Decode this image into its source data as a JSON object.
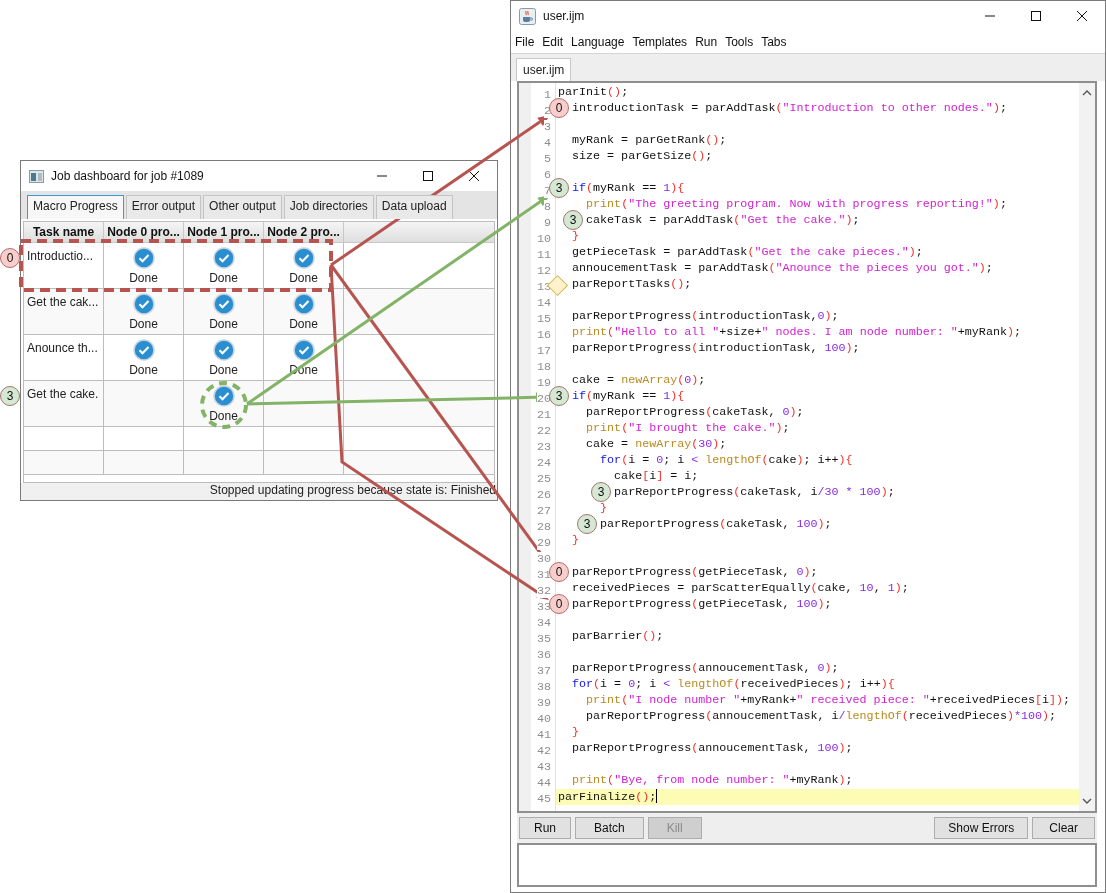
{
  "dashboard": {
    "title": "Job dashboard for job #1089",
    "tabs": [
      {
        "label": "Macro Progress",
        "selected": true
      },
      {
        "label": "Error output",
        "selected": false
      },
      {
        "label": "Other output",
        "selected": false
      },
      {
        "label": "Job directories",
        "selected": false
      },
      {
        "label": "Data upload",
        "selected": false
      }
    ],
    "columns": [
      "Task name",
      "Node 0 pro...",
      "Node 1 pro...",
      "Node 2 pro..."
    ],
    "rows": [
      {
        "marker": {
          "label": "0",
          "color": "#f8cecc"
        },
        "cells": [
          {
            "kind": "text",
            "text": "Introductio..."
          },
          {
            "kind": "status",
            "done": true,
            "status": "Done"
          },
          {
            "kind": "status",
            "done": true,
            "status": "Done"
          },
          {
            "kind": "status",
            "done": true,
            "status": "Done"
          }
        ]
      },
      {
        "cells": [
          {
            "kind": "text",
            "text": "Get the cak..."
          },
          {
            "kind": "status",
            "done": true,
            "status": "Done"
          },
          {
            "kind": "status",
            "done": true,
            "status": "Done"
          },
          {
            "kind": "status",
            "done": true,
            "status": "Done"
          }
        ]
      },
      {
        "cells": [
          {
            "kind": "text",
            "text": "Anounce th..."
          },
          {
            "kind": "status",
            "done": true,
            "status": "Done"
          },
          {
            "kind": "status",
            "done": true,
            "status": "Done"
          },
          {
            "kind": "status",
            "done": true,
            "status": "Done"
          }
        ]
      },
      {
        "marker": {
          "label": "3",
          "color": "#d5e8d4"
        },
        "cells": [
          {
            "kind": "text",
            "text": "Get the cake."
          },
          {
            "kind": "status",
            "done": false
          },
          {
            "kind": "status",
            "done": true,
            "status": "Done"
          },
          {
            "kind": "status",
            "done": false
          }
        ]
      }
    ],
    "status_bar": "Stopped updating progress because state is: Finished"
  },
  "editor": {
    "title": "user.ijm",
    "menu": [
      "File",
      "Edit",
      "Language",
      "Templates",
      "Run",
      "Tools",
      "Tabs"
    ],
    "file_tabs": [
      {
        "label": "user.ijm",
        "selected": true
      }
    ],
    "lines": [
      {
        "number": "1",
        "current": false,
        "tokens": [
          {
            "kind": "plain",
            "text": "parInit"
          },
          {
            "kind": "bracket",
            "text": "()"
          },
          {
            "kind": "plain",
            "text": ";"
          }
        ]
      },
      {
        "number": "2",
        "current": false,
        "marker": {
          "kind": "number",
          "label": "0",
          "color": "#f8cecc"
        },
        "tokens": [
          {
            "kind": "plain",
            "text": "  introductionTask = parAddTask"
          },
          {
            "kind": "bracket",
            "text": "("
          },
          {
            "kind": "string",
            "text": "\"Introduction to other nodes.\""
          },
          {
            "kind": "bracket",
            "text": ")"
          },
          {
            "kind": "plain",
            "text": ";"
          }
        ]
      },
      {
        "number": "3",
        "current": false
      },
      {
        "number": "4",
        "current": false,
        "tokens": [
          {
            "kind": "plain",
            "text": "  myRank = parGetRank"
          },
          {
            "kind": "bracket",
            "text": "()"
          },
          {
            "kind": "plain",
            "text": ";"
          }
        ]
      },
      {
        "number": "5",
        "current": false,
        "tokens": [
          {
            "kind": "plain",
            "text": "  size = parGetSize"
          },
          {
            "kind": "bracket",
            "text": "()"
          },
          {
            "kind": "plain",
            "text": ";"
          }
        ]
      },
      {
        "number": "6",
        "current": false
      },
      {
        "number": "7",
        "current": false,
        "marker": {
          "kind": "number",
          "label": "3",
          "color": "#d5e8d4"
        },
        "tokens": [
          {
            "kind": "keyword",
            "text": "  if"
          },
          {
            "kind": "bracket",
            "text": "("
          },
          {
            "kind": "plain",
            "text": "myRank == "
          },
          {
            "kind": "number",
            "text": "1"
          },
          {
            "kind": "bracket",
            "text": "){"
          }
        ]
      },
      {
        "number": "8",
        "current": false,
        "tokens": [
          {
            "kind": "builtin",
            "text": "    print"
          },
          {
            "kind": "bracket",
            "text": "("
          },
          {
            "kind": "string",
            "text": "\"The greeting program. Now with progress reporting!\""
          },
          {
            "kind": "bracket",
            "text": ")"
          },
          {
            "kind": "plain",
            "text": ";"
          }
        ]
      },
      {
        "number": "9",
        "current": false,
        "marker": {
          "kind": "number",
          "label": "3",
          "color": "#d5e8d4"
        },
        "tokens": [
          {
            "kind": "plain",
            "text": "    cakeTask = parAddTask"
          },
          {
            "kind": "bracket",
            "text": "("
          },
          {
            "kind": "string",
            "text": "\"Get the cake.\""
          },
          {
            "kind": "bracket",
            "text": ")"
          },
          {
            "kind": "plain",
            "text": ";"
          }
        ]
      },
      {
        "number": "10",
        "current": false,
        "tokens": [
          {
            "kind": "bracket",
            "text": "  }"
          }
        ]
      },
      {
        "number": "11",
        "current": false,
        "tokens": [
          {
            "kind": "plain",
            "text": "  getPieceTask = parAddTask"
          },
          {
            "kind": "bracket",
            "text": "("
          },
          {
            "kind": "string",
            "text": "\"Get the cake pieces.\""
          },
          {
            "kind": "bracket",
            "text": ")"
          },
          {
            "kind": "plain",
            "text": ";"
          }
        ]
      },
      {
        "number": "12",
        "current": false,
        "tokens": [
          {
            "kind": "plain",
            "text": "  annoucementTask = parAddTask"
          },
          {
            "kind": "bracket",
            "text": "("
          },
          {
            "kind": "string",
            "text": "\"Anounce the pieces you got.\""
          },
          {
            "kind": "bracket",
            "text": ")"
          },
          {
            "kind": "plain",
            "text": ";"
          }
        ]
      },
      {
        "number": "13",
        "current": false,
        "marker": {
          "kind": "diamond",
          "color": "#fff2cc"
        },
        "tokens": [
          {
            "kind": "plain",
            "text": "  parReportTasks"
          },
          {
            "kind": "bracket",
            "text": "()"
          },
          {
            "kind": "plain",
            "text": ";"
          }
        ]
      },
      {
        "number": "14",
        "current": false
      },
      {
        "number": "15",
        "current": false,
        "tokens": [
          {
            "kind": "plain",
            "text": "  parReportProgress"
          },
          {
            "kind": "bracket",
            "text": "("
          },
          {
            "kind": "plain",
            "text": "introductionTask,"
          },
          {
            "kind": "number",
            "text": "0"
          },
          {
            "kind": "bracket",
            "text": ")"
          },
          {
            "kind": "plain",
            "text": ";"
          }
        ]
      },
      {
        "number": "16",
        "current": false,
        "tokens": [
          {
            "kind": "builtin",
            "text": "  print"
          },
          {
            "kind": "bracket",
            "text": "("
          },
          {
            "kind": "string",
            "text": "\"Hello to all \""
          },
          {
            "kind": "plain",
            "text": "+size+"
          },
          {
            "kind": "string",
            "text": "\" nodes. I am node number: \""
          },
          {
            "kind": "plain",
            "text": "+myRank"
          },
          {
            "kind": "bracket",
            "text": ")"
          },
          {
            "kind": "plain",
            "text": ";"
          }
        ]
      },
      {
        "number": "17",
        "current": false,
        "tokens": [
          {
            "kind": "plain",
            "text": "  parReportProgress"
          },
          {
            "kind": "bracket",
            "text": "("
          },
          {
            "kind": "plain",
            "text": "introductionTask, "
          },
          {
            "kind": "number",
            "text": "100"
          },
          {
            "kind": "bracket",
            "text": ")"
          },
          {
            "kind": "plain",
            "text": ";"
          }
        ]
      },
      {
        "number": "18",
        "current": false
      },
      {
        "number": "19",
        "current": false,
        "tokens": [
          {
            "kind": "plain",
            "text": "  cake = "
          },
          {
            "kind": "builtin",
            "text": "newArray"
          },
          {
            "kind": "bracket",
            "text": "("
          },
          {
            "kind": "number",
            "text": "0"
          },
          {
            "kind": "bracket",
            "text": ")"
          },
          {
            "kind": "plain",
            "text": ";"
          }
        ]
      },
      {
        "number": "20",
        "current": false,
        "marker": {
          "kind": "number",
          "label": "3",
          "color": "#d5e8d4"
        },
        "tokens": [
          {
            "kind": "keyword",
            "text": "  if"
          },
          {
            "kind": "bracket",
            "text": "("
          },
          {
            "kind": "plain",
            "text": "myRank == "
          },
          {
            "kind": "number",
            "text": "1"
          },
          {
            "kind": "bracket",
            "text": "){"
          }
        ]
      },
      {
        "number": "21",
        "current": false,
        "tokens": [
          {
            "kind": "plain",
            "text": "    parReportProgress"
          },
          {
            "kind": "bracket",
            "text": "("
          },
          {
            "kind": "plain",
            "text": "cakeTask, "
          },
          {
            "kind": "number",
            "text": "0"
          },
          {
            "kind": "bracket",
            "text": ")"
          },
          {
            "kind": "plain",
            "text": ";"
          }
        ]
      },
      {
        "number": "22",
        "current": false,
        "tokens": [
          {
            "kind": "builtin",
            "text": "    print"
          },
          {
            "kind": "bracket",
            "text": "("
          },
          {
            "kind": "string",
            "text": "\"I brought the cake.\""
          },
          {
            "kind": "bracket",
            "text": ")"
          },
          {
            "kind": "plain",
            "text": ";"
          }
        ]
      },
      {
        "number": "23",
        "current": false,
        "tokens": [
          {
            "kind": "plain",
            "text": "    cake = "
          },
          {
            "kind": "builtin",
            "text": "newArray"
          },
          {
            "kind": "bracket",
            "text": "("
          },
          {
            "kind": "number",
            "text": "30"
          },
          {
            "kind": "bracket",
            "text": ")"
          },
          {
            "kind": "plain",
            "text": ";"
          }
        ]
      },
      {
        "number": "24",
        "current": false,
        "tokens": [
          {
            "kind": "keyword",
            "text": "      for"
          },
          {
            "kind": "bracket",
            "text": "("
          },
          {
            "kind": "plain",
            "text": "i = "
          },
          {
            "kind": "number",
            "text": "0"
          },
          {
            "kind": "plain",
            "text": "; i "
          },
          {
            "kind": "number",
            "text": "< "
          },
          {
            "kind": "builtin",
            "text": "lengthOf"
          },
          {
            "kind": "bracket",
            "text": "("
          },
          {
            "kind": "plain",
            "text": "cake"
          },
          {
            "kind": "bracket",
            "text": ")"
          },
          {
            "kind": "plain",
            "text": "; i++"
          },
          {
            "kind": "bracket",
            "text": "){"
          }
        ]
      },
      {
        "number": "25",
        "current": false,
        "tokens": [
          {
            "kind": "plain",
            "text": "        cake"
          },
          {
            "kind": "bracket",
            "text": "["
          },
          {
            "kind": "plain",
            "text": "i"
          },
          {
            "kind": "bracket",
            "text": "]"
          },
          {
            "kind": "plain",
            "text": " = i;"
          }
        ]
      },
      {
        "number": "26",
        "current": false,
        "marker": {
          "kind": "number",
          "label": "3",
          "color": "#d5e8d4"
        },
        "tokens": [
          {
            "kind": "plain",
            "text": "        parReportProgress"
          },
          {
            "kind": "bracket",
            "text": "("
          },
          {
            "kind": "plain",
            "text": "cakeTask, i"
          },
          {
            "kind": "number",
            "text": "/30 * 100"
          },
          {
            "kind": "bracket",
            "text": ")"
          },
          {
            "kind": "plain",
            "text": ";"
          }
        ]
      },
      {
        "number": "27",
        "current": false,
        "tokens": [
          {
            "kind": "bracket",
            "text": "      }"
          }
        ]
      },
      {
        "number": "28",
        "current": false,
        "marker": {
          "kind": "number",
          "label": "3",
          "color": "#d5e8d4"
        },
        "tokens": [
          {
            "kind": "plain",
            "text": "      parReportProgress"
          },
          {
            "kind": "bracket",
            "text": "("
          },
          {
            "kind": "plain",
            "text": "cakeTask, "
          },
          {
            "kind": "number",
            "text": "100"
          },
          {
            "kind": "bracket",
            "text": ")"
          },
          {
            "kind": "plain",
            "text": ";"
          }
        ]
      },
      {
        "number": "29",
        "current": false,
        "tokens": [
          {
            "kind": "bracket",
            "text": "  }"
          }
        ]
      },
      {
        "number": "30",
        "current": false
      },
      {
        "number": "31",
        "current": false,
        "marker": {
          "kind": "number",
          "label": "0",
          "color": "#f8cecc"
        },
        "tokens": [
          {
            "kind": "plain",
            "text": "  parReportProgress"
          },
          {
            "kind": "bracket",
            "text": "("
          },
          {
            "kind": "plain",
            "text": "getPieceTask, "
          },
          {
            "kind": "number",
            "text": "0"
          },
          {
            "kind": "bracket",
            "text": ")"
          },
          {
            "kind": "plain",
            "text": ";"
          }
        ]
      },
      {
        "number": "32",
        "current": false,
        "tokens": [
          {
            "kind": "plain",
            "text": "  receivedPieces = parScatterEqually"
          },
          {
            "kind": "bracket",
            "text": "("
          },
          {
            "kind": "plain",
            "text": "cake, "
          },
          {
            "kind": "number",
            "text": "10"
          },
          {
            "kind": "plain",
            "text": ", "
          },
          {
            "kind": "number",
            "text": "1"
          },
          {
            "kind": "bracket",
            "text": ")"
          },
          {
            "kind": "plain",
            "text": ";"
          }
        ]
      },
      {
        "number": "33",
        "current": false,
        "marker": {
          "kind": "number",
          "label": "0",
          "color": "#f8cecc"
        },
        "tokens": [
          {
            "kind": "plain",
            "text": "  parReportProgress"
          },
          {
            "kind": "bracket",
            "text": "("
          },
          {
            "kind": "plain",
            "text": "getPieceTask, "
          },
          {
            "kind": "number",
            "text": "100"
          },
          {
            "kind": "bracket",
            "text": ")"
          },
          {
            "kind": "plain",
            "text": ";"
          }
        ]
      },
      {
        "number": "34",
        "current": false
      },
      {
        "number": "35",
        "current": false,
        "tokens": [
          {
            "kind": "plain",
            "text": "  parBarrier"
          },
          {
            "kind": "bracket",
            "text": "()"
          },
          {
            "kind": "plain",
            "text": ";"
          }
        ]
      },
      {
        "number": "36",
        "current": false
      },
      {
        "number": "37",
        "current": false,
        "tokens": [
          {
            "kind": "plain",
            "text": "  parReportProgress"
          },
          {
            "kind": "bracket",
            "text": "("
          },
          {
            "kind": "plain",
            "text": "annoucementTask, "
          },
          {
            "kind": "number",
            "text": "0"
          },
          {
            "kind": "bracket",
            "text": ")"
          },
          {
            "kind": "plain",
            "text": ";"
          }
        ]
      },
      {
        "number": "38",
        "current": false,
        "tokens": [
          {
            "kind": "keyword",
            "text": "  for"
          },
          {
            "kind": "bracket",
            "text": "("
          },
          {
            "kind": "plain",
            "text": "i = "
          },
          {
            "kind": "number",
            "text": "0"
          },
          {
            "kind": "plain",
            "text": "; i "
          },
          {
            "kind": "number",
            "text": "< "
          },
          {
            "kind": "builtin",
            "text": "lengthOf"
          },
          {
            "kind": "bracket",
            "text": "("
          },
          {
            "kind": "plain",
            "text": "receivedPieces"
          },
          {
            "kind": "bracket",
            "text": ")"
          },
          {
            "kind": "plain",
            "text": "; i++"
          },
          {
            "kind": "bracket",
            "text": "){"
          }
        ]
      },
      {
        "number": "39",
        "current": false,
        "tokens": [
          {
            "kind": "builtin",
            "text": "    print"
          },
          {
            "kind": "bracket",
            "text": "("
          },
          {
            "kind": "string",
            "text": "\"I node number \""
          },
          {
            "kind": "plain",
            "text": "+myRank+"
          },
          {
            "kind": "string",
            "text": "\" received piece: \""
          },
          {
            "kind": "plain",
            "text": "+receivedPieces"
          },
          {
            "kind": "bracket",
            "text": "["
          },
          {
            "kind": "plain",
            "text": "i"
          },
          {
            "kind": "bracket",
            "text": "])"
          },
          {
            "kind": "plain",
            "text": ";"
          }
        ]
      },
      {
        "number": "40",
        "current": false,
        "tokens": [
          {
            "kind": "plain",
            "text": "    parReportProgress"
          },
          {
            "kind": "bracket",
            "text": "("
          },
          {
            "kind": "plain",
            "text": "annoucementTask, i"
          },
          {
            "kind": "number",
            "text": "/"
          },
          {
            "kind": "builtin",
            "text": "lengthOf"
          },
          {
            "kind": "bracket",
            "text": "("
          },
          {
            "kind": "plain",
            "text": "receivedPieces"
          },
          {
            "kind": "bracket",
            "text": ")"
          },
          {
            "kind": "number",
            "text": "*100"
          },
          {
            "kind": "bracket",
            "text": ")"
          },
          {
            "kind": "plain",
            "text": ";"
          }
        ]
      },
      {
        "number": "41",
        "current": false,
        "tokens": [
          {
            "kind": "bracket",
            "text": "  }"
          }
        ]
      },
      {
        "number": "42",
        "current": false,
        "tokens": [
          {
            "kind": "plain",
            "text": "  parReportProgress"
          },
          {
            "kind": "bracket",
            "text": "("
          },
          {
            "kind": "plain",
            "text": "annoucementTask, "
          },
          {
            "kind": "number",
            "text": "100"
          },
          {
            "kind": "bracket",
            "text": ")"
          },
          {
            "kind": "plain",
            "text": ";"
          }
        ]
      },
      {
        "number": "43",
        "current": false
      },
      {
        "number": "44",
        "current": false,
        "tokens": [
          {
            "kind": "builtin",
            "text": "  print"
          },
          {
            "kind": "bracket",
            "text": "("
          },
          {
            "kind": "string",
            "text": "\"Bye, from node number: \""
          },
          {
            "kind": "plain",
            "text": "+myRank"
          },
          {
            "kind": "bracket",
            "text": ")"
          },
          {
            "kind": "plain",
            "text": ";"
          }
        ]
      },
      {
        "number": "45",
        "current": true,
        "tokens": [
          {
            "kind": "plain",
            "text": "parFinalize"
          },
          {
            "kind": "bracket",
            "text": "()"
          },
          {
            "kind": "plain",
            "text": ";"
          }
        ]
      }
    ],
    "left_buttons": [
      {
        "label": "Run",
        "disabled": false
      },
      {
        "label": "Batch",
        "disabled": false
      },
      {
        "label": "Kill",
        "disabled": true
      }
    ],
    "right_buttons": [
      {
        "label": "Show Errors",
        "disabled": false
      },
      {
        "label": "Clear",
        "disabled": false
      }
    ]
  }
}
